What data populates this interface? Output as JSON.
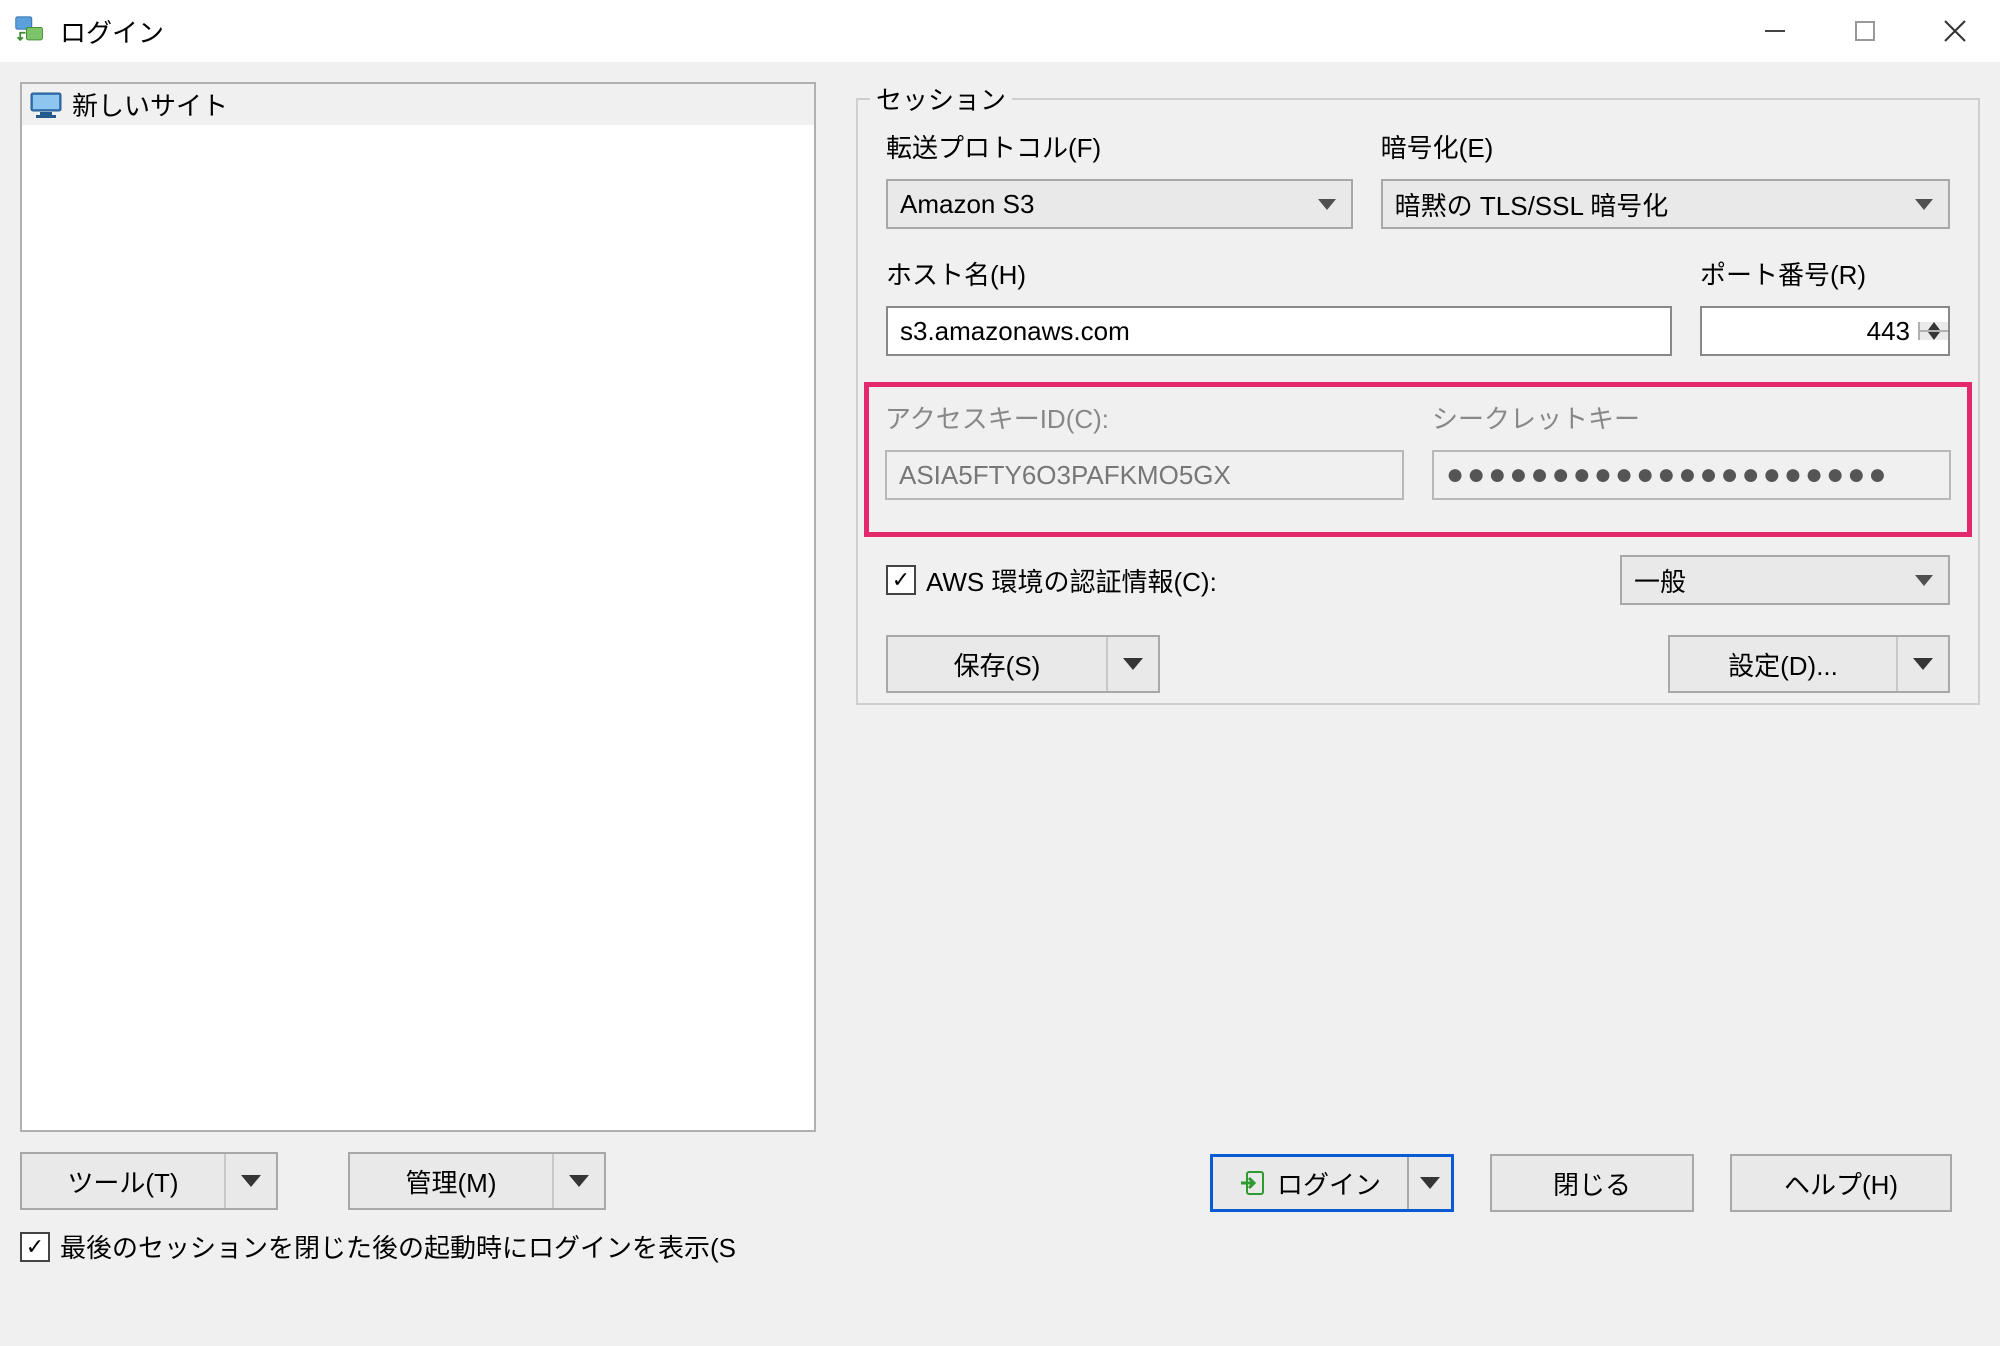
{
  "window": {
    "title": "ログイン"
  },
  "sites": {
    "new_site": "新しいサイト"
  },
  "left_buttons": {
    "tools": "ツール(T)",
    "manage": "管理(M)"
  },
  "session": {
    "legend": "セッション",
    "protocol_label": "転送プロトコル(F)",
    "protocol_value": "Amazon S3",
    "encryption_label": "暗号化(E)",
    "encryption_value": "暗黙の TLS/SSL 暗号化",
    "host_label": "ホスト名(H)",
    "host_value": "s3.amazonaws.com",
    "port_label": "ポート番号(R)",
    "port_value": "443",
    "access_key_label": "アクセスキーID(C):",
    "access_key_value": "ASIA5FTY6O3PAFKMO5GX",
    "secret_key_label": "シークレットキー",
    "secret_key_masked": "●●●●●●●●●●●●●●●●●●●●●",
    "aws_env_cred": "AWS 環境の認証情報(C):",
    "aws_env_value": "一般",
    "save": "保存(S)",
    "settings": "設定(D)..."
  },
  "bottom": {
    "login": "ログイン",
    "close": "閉じる",
    "help": "ヘルプ(H)"
  },
  "footer": {
    "show_on_startup": "最後のセッションを閉じた後の起動時にログインを表示(S"
  }
}
